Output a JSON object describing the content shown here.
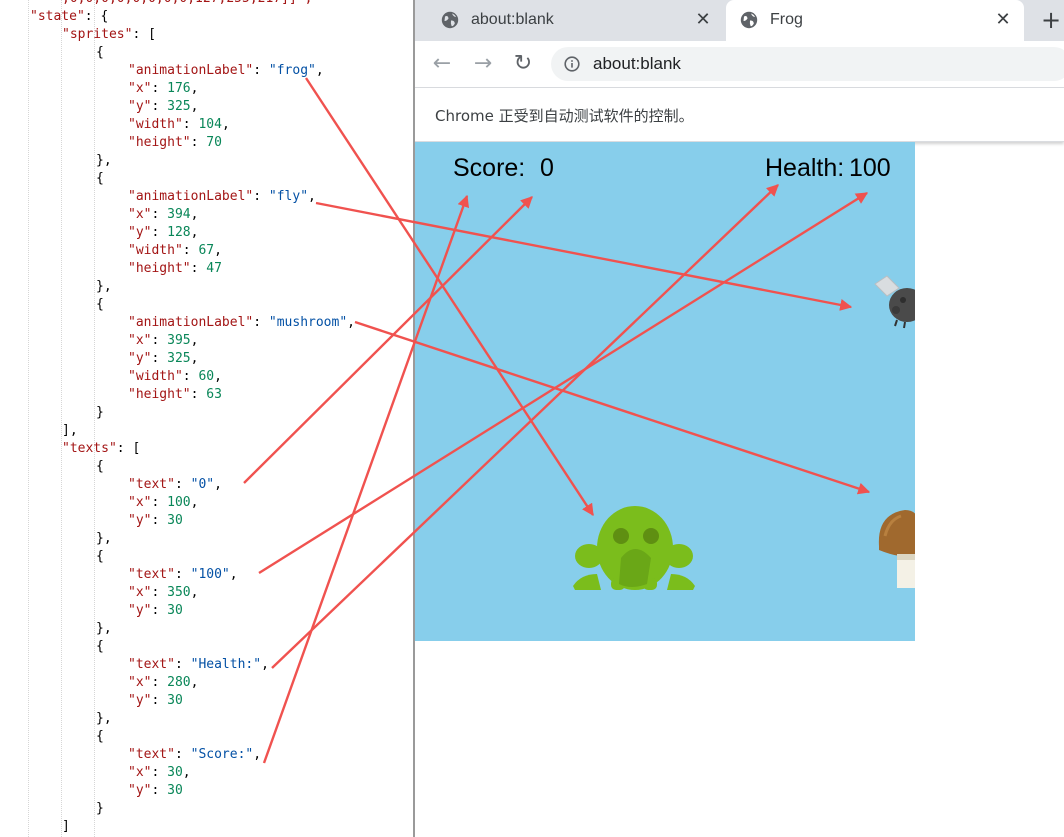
{
  "code_lines": [
    {
      "i": 2,
      "t": [
        [
          "k",
          ",0,0,0,0,0,0,0,0,127,255,217]]\","
        ]
      ]
    },
    {
      "i": 1,
      "t": [
        [
          "k",
          "\"state\""
        ],
        [
          "p",
          ": {"
        ]
      ]
    },
    {
      "i": 2,
      "t": [
        [
          "k",
          "\"sprites\""
        ],
        [
          "p",
          ": ["
        ]
      ]
    },
    {
      "i": 3,
      "t": [
        [
          "p",
          "{"
        ]
      ]
    },
    {
      "i": 4,
      "t": [
        [
          "k",
          "\"animationLabel\""
        ],
        [
          "p",
          ": "
        ],
        [
          "s",
          "\"frog\""
        ],
        [
          "p",
          ","
        ]
      ]
    },
    {
      "i": 4,
      "t": [
        [
          "k",
          "\"x\""
        ],
        [
          "p",
          ": "
        ],
        [
          "n",
          "176"
        ],
        [
          "p",
          ","
        ]
      ]
    },
    {
      "i": 4,
      "t": [
        [
          "k",
          "\"y\""
        ],
        [
          "p",
          ": "
        ],
        [
          "n",
          "325"
        ],
        [
          "p",
          ","
        ]
      ]
    },
    {
      "i": 4,
      "t": [
        [
          "k",
          "\"width\""
        ],
        [
          "p",
          ": "
        ],
        [
          "n",
          "104"
        ],
        [
          "p",
          ","
        ]
      ]
    },
    {
      "i": 4,
      "t": [
        [
          "k",
          "\"height\""
        ],
        [
          "p",
          ": "
        ],
        [
          "n",
          "70"
        ]
      ]
    },
    {
      "i": 3,
      "t": [
        [
          "p",
          "},"
        ]
      ]
    },
    {
      "i": 3,
      "t": [
        [
          "p",
          "{"
        ]
      ]
    },
    {
      "i": 4,
      "t": [
        [
          "k",
          "\"animationLabel\""
        ],
        [
          "p",
          ": "
        ],
        [
          "s",
          "\"fly\""
        ],
        [
          "p",
          ","
        ]
      ]
    },
    {
      "i": 4,
      "t": [
        [
          "k",
          "\"x\""
        ],
        [
          "p",
          ": "
        ],
        [
          "n",
          "394"
        ],
        [
          "p",
          ","
        ]
      ]
    },
    {
      "i": 4,
      "t": [
        [
          "k",
          "\"y\""
        ],
        [
          "p",
          ": "
        ],
        [
          "n",
          "128"
        ],
        [
          "p",
          ","
        ]
      ]
    },
    {
      "i": 4,
      "t": [
        [
          "k",
          "\"width\""
        ],
        [
          "p",
          ": "
        ],
        [
          "n",
          "67"
        ],
        [
          "p",
          ","
        ]
      ]
    },
    {
      "i": 4,
      "t": [
        [
          "k",
          "\"height\""
        ],
        [
          "p",
          ": "
        ],
        [
          "n",
          "47"
        ]
      ]
    },
    {
      "i": 3,
      "t": [
        [
          "p",
          "},"
        ]
      ]
    },
    {
      "i": 3,
      "t": [
        [
          "p",
          "{"
        ]
      ]
    },
    {
      "i": 4,
      "t": [
        [
          "k",
          "\"animationLabel\""
        ],
        [
          "p",
          ": "
        ],
        [
          "s",
          "\"mushroom\""
        ],
        [
          "p",
          ","
        ]
      ]
    },
    {
      "i": 4,
      "t": [
        [
          "k",
          "\"x\""
        ],
        [
          "p",
          ": "
        ],
        [
          "n",
          "395"
        ],
        [
          "p",
          ","
        ]
      ]
    },
    {
      "i": 4,
      "t": [
        [
          "k",
          "\"y\""
        ],
        [
          "p",
          ": "
        ],
        [
          "n",
          "325"
        ],
        [
          "p",
          ","
        ]
      ]
    },
    {
      "i": 4,
      "t": [
        [
          "k",
          "\"width\""
        ],
        [
          "p",
          ": "
        ],
        [
          "n",
          "60"
        ],
        [
          "p",
          ","
        ]
      ]
    },
    {
      "i": 4,
      "t": [
        [
          "k",
          "\"height\""
        ],
        [
          "p",
          ": "
        ],
        [
          "n",
          "63"
        ]
      ]
    },
    {
      "i": 3,
      "t": [
        [
          "p",
          "}"
        ]
      ]
    },
    {
      "i": 2,
      "t": [
        [
          "p",
          "],"
        ]
      ]
    },
    {
      "i": 2,
      "t": [
        [
          "k",
          "\"texts\""
        ],
        [
          "p",
          ": ["
        ]
      ]
    },
    {
      "i": 3,
      "t": [
        [
          "p",
          "{"
        ]
      ]
    },
    {
      "i": 4,
      "t": [
        [
          "k",
          "\"text\""
        ],
        [
          "p",
          ": "
        ],
        [
          "s",
          "\"0\""
        ],
        [
          "p",
          ","
        ]
      ]
    },
    {
      "i": 4,
      "t": [
        [
          "k",
          "\"x\""
        ],
        [
          "p",
          ": "
        ],
        [
          "n",
          "100"
        ],
        [
          "p",
          ","
        ]
      ]
    },
    {
      "i": 4,
      "t": [
        [
          "k",
          "\"y\""
        ],
        [
          "p",
          ": "
        ],
        [
          "n",
          "30"
        ]
      ]
    },
    {
      "i": 3,
      "t": [
        [
          "p",
          "},"
        ]
      ]
    },
    {
      "i": 3,
      "t": [
        [
          "p",
          "{"
        ]
      ]
    },
    {
      "i": 4,
      "t": [
        [
          "k",
          "\"text\""
        ],
        [
          "p",
          ": "
        ],
        [
          "s",
          "\"100\""
        ],
        [
          "p",
          ","
        ]
      ]
    },
    {
      "i": 4,
      "t": [
        [
          "k",
          "\"x\""
        ],
        [
          "p",
          ": "
        ],
        [
          "n",
          "350"
        ],
        [
          "p",
          ","
        ]
      ]
    },
    {
      "i": 4,
      "t": [
        [
          "k",
          "\"y\""
        ],
        [
          "p",
          ": "
        ],
        [
          "n",
          "30"
        ]
      ]
    },
    {
      "i": 3,
      "t": [
        [
          "p",
          "},"
        ]
      ]
    },
    {
      "i": 3,
      "t": [
        [
          "p",
          "{"
        ]
      ]
    },
    {
      "i": 4,
      "t": [
        [
          "k",
          "\"text\""
        ],
        [
          "p",
          ": "
        ],
        [
          "s",
          "\"Health:\""
        ],
        [
          "p",
          ","
        ]
      ]
    },
    {
      "i": 4,
      "t": [
        [
          "k",
          "\"x\""
        ],
        [
          "p",
          ": "
        ],
        [
          "n",
          "280"
        ],
        [
          "p",
          ","
        ]
      ]
    },
    {
      "i": 4,
      "t": [
        [
          "k",
          "\"y\""
        ],
        [
          "p",
          ": "
        ],
        [
          "n",
          "30"
        ]
      ]
    },
    {
      "i": 3,
      "t": [
        [
          "p",
          "},"
        ]
      ]
    },
    {
      "i": 3,
      "t": [
        [
          "p",
          "{"
        ]
      ]
    },
    {
      "i": 4,
      "t": [
        [
          "k",
          "\"text\""
        ],
        [
          "p",
          ": "
        ],
        [
          "s",
          "\"Score:\""
        ],
        [
          "p",
          ","
        ]
      ]
    },
    {
      "i": 4,
      "t": [
        [
          "k",
          "\"x\""
        ],
        [
          "p",
          ": "
        ],
        [
          "n",
          "30"
        ],
        [
          "p",
          ","
        ]
      ]
    },
    {
      "i": 4,
      "t": [
        [
          "k",
          "\"y\""
        ],
        [
          "p",
          ": "
        ],
        [
          "n",
          "30"
        ]
      ]
    },
    {
      "i": 3,
      "t": [
        [
          "p",
          "}"
        ]
      ]
    },
    {
      "i": 2,
      "t": [
        [
          "p",
          "]"
        ]
      ]
    }
  ],
  "browser": {
    "tabs": [
      {
        "title": "about:blank",
        "close": "✕",
        "icon": "globe-icon"
      },
      {
        "title": "Frog",
        "close": "✕",
        "icon": "globe-icon"
      }
    ],
    "new_tab": "+",
    "back": "←",
    "forward": "→",
    "reload": "↻",
    "url": "about:blank",
    "infobar": "Chrome 正受到自动测试软件的控制。"
  },
  "game": {
    "score_label": "Score:",
    "score_value": "0",
    "health_label": "Health:",
    "health_value": "100",
    "sprites": [
      "frog",
      "fly",
      "mushroom"
    ]
  },
  "colors": {
    "game_background": "#87ceeb",
    "arrow": "#f0524f",
    "frog": "#7bbd1c"
  }
}
